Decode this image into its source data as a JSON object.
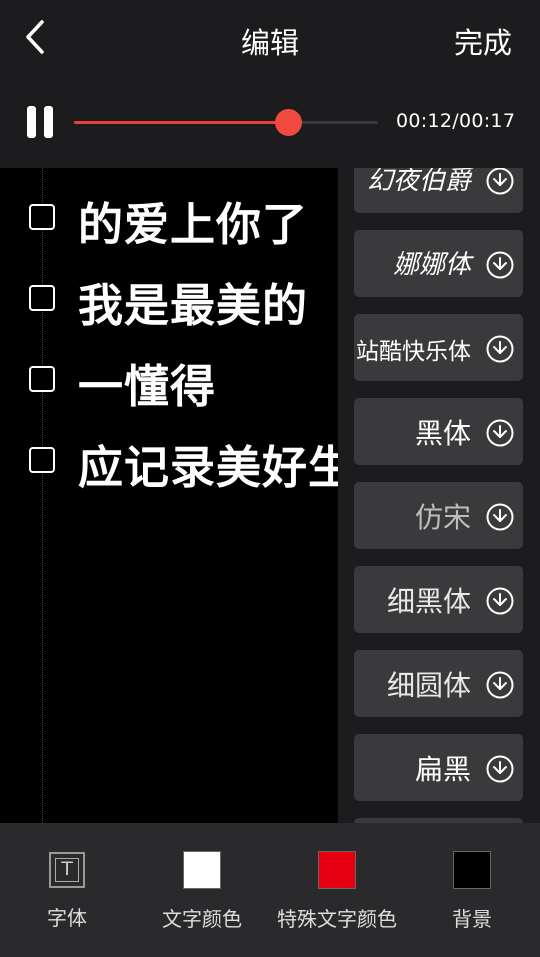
{
  "header": {
    "title": "编辑",
    "done_label": "完成"
  },
  "playback": {
    "time": "00:12/00:17",
    "progress": 0.705
  },
  "preview": {
    "lines": [
      {
        "text": "的爱上你了"
      },
      {
        "text": "我是最美的"
      },
      {
        "text": "一懂得"
      },
      {
        "text": "应记录美好生"
      }
    ]
  },
  "fonts": [
    {
      "name": "幻夜伯爵"
    },
    {
      "name": "娜娜体"
    },
    {
      "name": "站酷快乐体"
    },
    {
      "name": "黑体"
    },
    {
      "name": "仿宋"
    },
    {
      "name": "细黑体"
    },
    {
      "name": "细圆体"
    },
    {
      "name": "扁黑"
    }
  ],
  "toolbar": {
    "font_label": "字体",
    "text_color_label": "文字颜色",
    "special_color_label": "特殊文字颜色",
    "background_label": "背景",
    "text_color": "#ffffff",
    "special_color": "#e60012",
    "background_color": "#000000"
  },
  "colors": {
    "accent": "#f04a3f",
    "panel": "#1c1c1e",
    "card": "#3a3a3c"
  }
}
